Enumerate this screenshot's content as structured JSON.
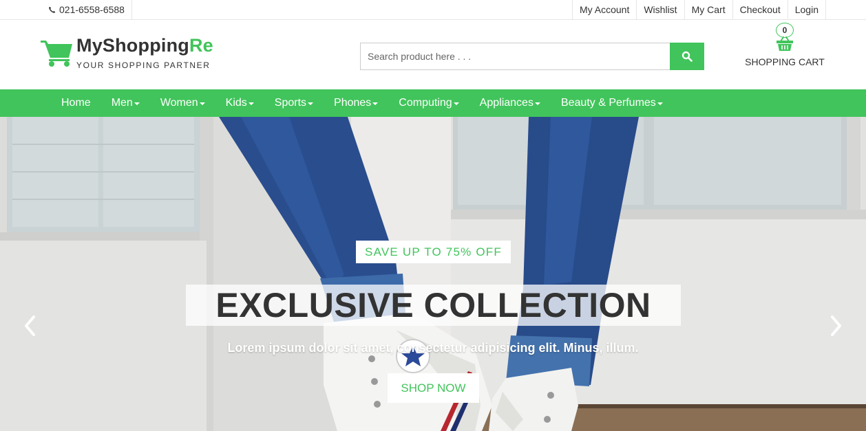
{
  "topbar": {
    "phone": "021-6558-6588",
    "links": [
      "My Account",
      "Wishlist",
      "My Cart",
      "Checkout",
      "Login"
    ]
  },
  "logo": {
    "title_main": "MyShopping",
    "title_accent": "Re",
    "tagline": "YOUR SHOPPING PARTNER",
    "icon": "shopping-cart-icon"
  },
  "search": {
    "placeholder": "Search product here . . .",
    "value": "",
    "button_icon": "search-icon"
  },
  "cart": {
    "count": "0",
    "label": "SHOPPING CART",
    "icon": "basket-icon"
  },
  "nav": {
    "items": [
      {
        "label": "Home",
        "dropdown": false
      },
      {
        "label": "Men",
        "dropdown": true
      },
      {
        "label": "Women",
        "dropdown": true
      },
      {
        "label": "Kids",
        "dropdown": true
      },
      {
        "label": "Sports",
        "dropdown": true
      },
      {
        "label": "Phones",
        "dropdown": true
      },
      {
        "label": "Computing",
        "dropdown": true
      },
      {
        "label": "Appliances",
        "dropdown": true
      },
      {
        "label": "Beauty & Perfumes",
        "dropdown": true
      }
    ]
  },
  "hero": {
    "badge": "SAVE UP TO 75% OFF",
    "title": "EXCLUSIVE COLLECTION",
    "subtitle": "Lorem ipsum dolor sit amet, consectetur adipisicing elit. Minus, illum.",
    "button": "SHOP NOW",
    "prev_icon": "chevron-left-icon",
    "next_icon": "chevron-right-icon"
  },
  "colors": {
    "accent": "#41c45b",
    "text": "#333333"
  }
}
